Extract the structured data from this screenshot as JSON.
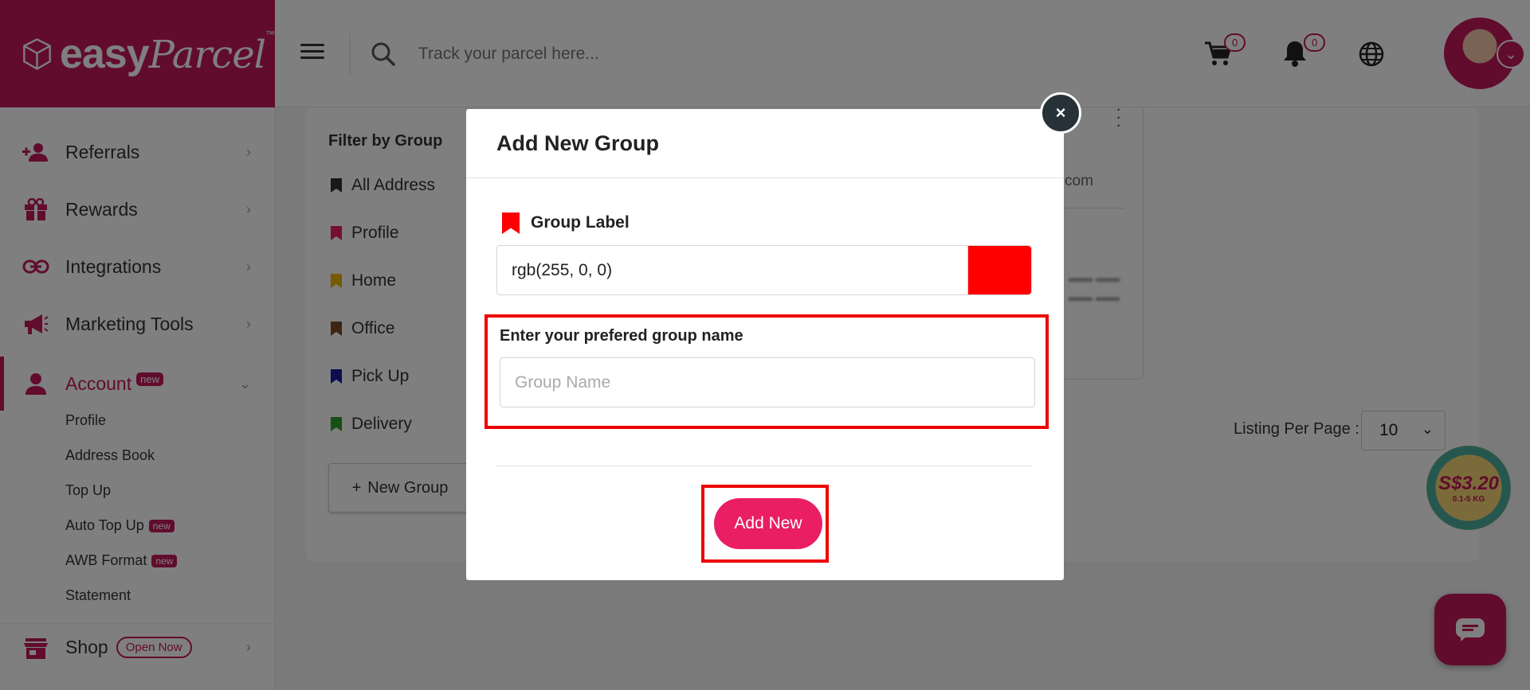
{
  "brand": {
    "logo_text": "easy",
    "logo_script": "Parcel",
    "tm": "™",
    "color": "#c2185b"
  },
  "header": {
    "search_placeholder": "Track your parcel here...",
    "cart_count": "0",
    "notification_count": "0"
  },
  "sidebar": {
    "items": [
      {
        "label": "Referrals",
        "icon": "referral-icon"
      },
      {
        "label": "Rewards",
        "icon": "gift-icon"
      },
      {
        "label": "Integrations",
        "icon": "link-icon"
      },
      {
        "label": "Marketing Tools",
        "icon": "megaphone-icon"
      },
      {
        "label": "Account",
        "icon": "user-icon",
        "badge": "new",
        "active": true
      },
      {
        "label": "Shop",
        "icon": "shop-icon",
        "badge": "Open Now"
      }
    ],
    "account_sub": [
      {
        "label": "Profile"
      },
      {
        "label": "Address Book"
      },
      {
        "label": "Top Up"
      },
      {
        "label": "Auto Top Up",
        "badge": "new"
      },
      {
        "label": "AWB Format",
        "badge": "new"
      },
      {
        "label": "Statement"
      }
    ]
  },
  "filter": {
    "title": "Filter by Group",
    "groups": [
      {
        "label": "All Address",
        "color": "#333333"
      },
      {
        "label": "Profile",
        "color": "#e91e63"
      },
      {
        "label": "Home",
        "color": "#f0b400"
      },
      {
        "label": "Office",
        "color": "#7b4a2a"
      },
      {
        "label": "Pick Up",
        "color": "#1a1aa0"
      },
      {
        "label": "Delivery",
        "color": "#2e9e2e"
      }
    ],
    "new_group_label": "New Group"
  },
  "address_card": {
    "email_suffix": "com"
  },
  "listing": {
    "label": "Listing Per Page :",
    "value": "10"
  },
  "promo": {
    "price": "S$3.20",
    "weight": "0.1-5 KG"
  },
  "modal": {
    "title": "Add New Group",
    "group_label_title": "Group Label",
    "color_value": "rgb(255, 0, 0)",
    "color_swatch": "#ff0000",
    "name_label": "Enter your prefered group name",
    "name_placeholder": "Group Name",
    "name_value": "",
    "submit_label": "Add New",
    "close_label": "×"
  }
}
